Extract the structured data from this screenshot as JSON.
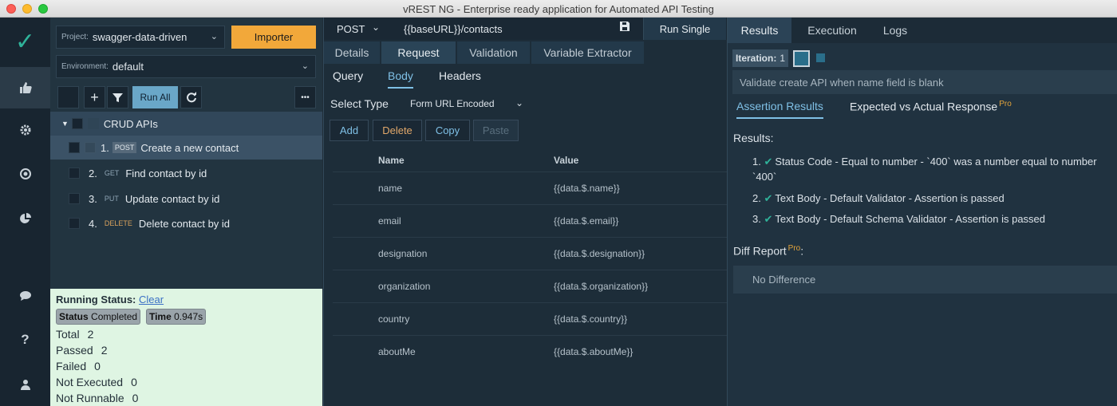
{
  "window": {
    "title": "vREST NG - Enterprise ready application for Automated API Testing"
  },
  "sidebar": {
    "icons": [
      "check-icon",
      "thumbs-up-icon",
      "gear-icon",
      "target-icon",
      "pie-chart-icon",
      "chat-icon",
      "help-icon",
      "user-icon"
    ]
  },
  "project": {
    "label": "Project:",
    "value": "swagger-data-driven",
    "importer_label": "Importer"
  },
  "environment": {
    "label": "Environment:",
    "value": "default"
  },
  "toolbar": {
    "run_all_label": "Run All",
    "more_label": "•••"
  },
  "tree": {
    "group": "CRUD APIs",
    "items": [
      {
        "index": "1.",
        "method": "POST",
        "name": "Create a new contact"
      },
      {
        "index": "2.",
        "method": "GET",
        "name": "Find contact by id"
      },
      {
        "index": "3.",
        "method": "PUT",
        "name": "Update contact by id"
      },
      {
        "index": "4.",
        "method": "DELETE",
        "name": "Delete contact by id"
      }
    ]
  },
  "running_status": {
    "title": "Running Status:",
    "clear": "Clear",
    "status_label": "Status",
    "status_value": "Completed",
    "time_label": "Time",
    "time_value": "0.947s",
    "stats": [
      {
        "label": "Total",
        "value": "2"
      },
      {
        "label": "Passed",
        "value": "2"
      },
      {
        "label": "Failed",
        "value": "0"
      },
      {
        "label": "Not Executed",
        "value": "0"
      },
      {
        "label": "Not Runnable",
        "value": "0"
      }
    ]
  },
  "request": {
    "method": "POST",
    "url": "{{baseURL}}/contacts",
    "run_single": "Run Single",
    "tabs": [
      "Details",
      "Request",
      "Validation",
      "Variable Extractor"
    ],
    "subtabs": [
      "Query",
      "Body",
      "Headers"
    ],
    "select_type_label": "Select Type",
    "select_type_value": "Form URL Encoded",
    "actions": [
      "Add",
      "Delete",
      "Copy",
      "Paste"
    ],
    "columns": [
      "Name",
      "Value"
    ],
    "rows": [
      {
        "name": "name",
        "value": "{{data.$.name}}"
      },
      {
        "name": "email",
        "value": "{{data.$.email}}"
      },
      {
        "name": "designation",
        "value": "{{data.$.designation}}"
      },
      {
        "name": "organization",
        "value": "{{data.$.organization}}"
      },
      {
        "name": "country",
        "value": "{{data.$.country}}"
      },
      {
        "name": "aboutMe",
        "value": "{{data.$.aboutMe}}"
      }
    ]
  },
  "results": {
    "tabs": [
      "Results",
      "Execution",
      "Logs"
    ],
    "iteration_label": "Iteration:",
    "iteration_value": "1",
    "description": "Validate create API when name field is blank",
    "assertion_tab": "Assertion Results",
    "expected_tab": "Expected vs Actual Response",
    "pro": "Pro",
    "results_heading": "Results:",
    "items": [
      {
        "index": "1.",
        "text": "Status Code - Equal to number - `400` was a number equal to number `400`"
      },
      {
        "index": "2.",
        "text": "Text Body - Default Validator - Assertion is passed"
      },
      {
        "index": "3.",
        "text": "Text Body - Default Schema Validator - Assertion is passed"
      }
    ],
    "diff_heading": "Diff Report",
    "diff_suffix": ":",
    "diff_value": "No Difference"
  },
  "colors": {
    "accent": "#7fc0e6",
    "importer": "#f2a83a",
    "success": "#2fb39a",
    "status_bg": "#dff5e3"
  }
}
